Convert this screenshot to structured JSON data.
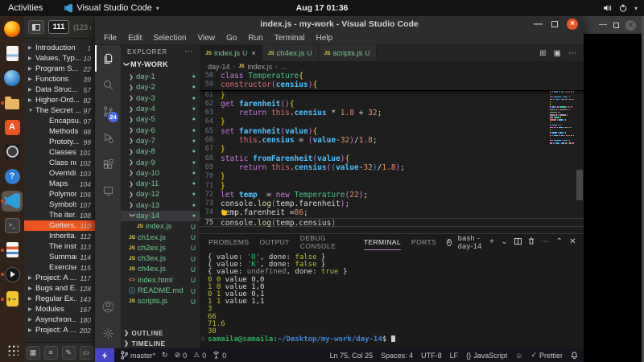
{
  "gnome": {
    "activities": "Activities",
    "app_menu": "Visual Studio Code",
    "clock": "Aug 17 01:36"
  },
  "dock": {
    "items": [
      {
        "id": "firefox",
        "running": false,
        "focused": false
      },
      {
        "id": "writer",
        "running": false,
        "focused": false
      },
      {
        "id": "tbird",
        "running": false,
        "focused": false
      },
      {
        "id": "files",
        "running": true,
        "focused": false
      },
      {
        "id": "software",
        "running": false,
        "focused": false
      },
      {
        "id": "rhythm",
        "running": false,
        "focused": false
      },
      {
        "id": "help",
        "running": false,
        "focused": false
      },
      {
        "id": "vscode",
        "running": true,
        "focused": true
      },
      {
        "id": "terminal",
        "running": false,
        "focused": false
      },
      {
        "id": "impress",
        "running": true,
        "focused": false
      },
      {
        "id": "player",
        "running": true,
        "focused": false
      },
      {
        "id": "calc",
        "running": true,
        "focused": false
      }
    ],
    "show_apps": {
      "id": "apps"
    }
  },
  "pdf_viewer": {
    "page_input": "111",
    "page_total": "(123 o",
    "toc": [
      {
        "label": "Introduction",
        "page": "1",
        "level": 0,
        "state": "c"
      },
      {
        "label": "Values, Typ...",
        "page": "10",
        "level": 0,
        "state": "c"
      },
      {
        "label": "Program S...",
        "page": "22",
        "level": 0,
        "state": "c"
      },
      {
        "label": "Functions",
        "page": "39",
        "level": 0,
        "state": "c"
      },
      {
        "label": "Data Struc...",
        "page": "57",
        "level": 0,
        "state": "c"
      },
      {
        "label": "Higher-Ord...",
        "page": "82",
        "level": 0,
        "state": "c"
      },
      {
        "label": "The Secret ...",
        "page": "97",
        "level": 0,
        "state": "e"
      },
      {
        "label": "Encapsu...",
        "page": "97",
        "level": 1,
        "state": ""
      },
      {
        "label": "Methods",
        "page": "98",
        "level": 1,
        "state": ""
      },
      {
        "label": "Prototy...",
        "page": "99",
        "level": 1,
        "state": ""
      },
      {
        "label": "Classes",
        "page": "101",
        "level": 1,
        "state": ""
      },
      {
        "label": "Class no...",
        "page": "102",
        "level": 1,
        "state": ""
      },
      {
        "label": "Overridi...",
        "page": "103",
        "level": 1,
        "state": ""
      },
      {
        "label": "Maps",
        "page": "104",
        "level": 1,
        "state": ""
      },
      {
        "label": "Polymor...",
        "page": "106",
        "level": 1,
        "state": ""
      },
      {
        "label": "Symbols",
        "page": "107",
        "level": 1,
        "state": ""
      },
      {
        "label": "The iter...",
        "page": "108",
        "level": 1,
        "state": ""
      },
      {
        "label": "Getters,...",
        "page": "110",
        "level": 1,
        "state": "",
        "selected": true
      },
      {
        "label": "Inherita...",
        "page": "112",
        "level": 1,
        "state": ""
      },
      {
        "label": "The inst...",
        "page": "113",
        "level": 1,
        "state": ""
      },
      {
        "label": "Summary",
        "page": "114",
        "level": 1,
        "state": ""
      },
      {
        "label": "Exercises",
        "page": "115",
        "level": 1,
        "state": ""
      },
      {
        "label": "Project: A ...",
        "page": "117",
        "level": 0,
        "state": "c"
      },
      {
        "label": "Bugs and E...",
        "page": "128",
        "level": 0,
        "state": "c"
      },
      {
        "label": "Regular Ex...",
        "page": "143",
        "level": 0,
        "state": "c"
      },
      {
        "label": "Modules",
        "page": "167",
        "level": 0,
        "state": "c"
      },
      {
        "label": "Asynchron...",
        "page": "180",
        "level": 0,
        "state": "c"
      },
      {
        "label": "Project: A ...",
        "page": "202",
        "level": 0,
        "state": "c"
      }
    ]
  },
  "vscode": {
    "title": "index.js - my-work - Visual Studio Code",
    "menus": [
      "File",
      "Edit",
      "Selection",
      "View",
      "Go",
      "Run",
      "Terminal",
      "Help"
    ],
    "activity": {
      "scm_badge": "24"
    },
    "explorer": {
      "header": "EXPLORER",
      "root": "MY-WORK",
      "outline": "OUTLINE",
      "timeline": "TIMELINE",
      "items": [
        {
          "label": "day-1",
          "kind": "folder",
          "badge": "dot"
        },
        {
          "label": "day-2",
          "kind": "folder",
          "badge": "dot"
        },
        {
          "label": "day-3",
          "kind": "folder",
          "badge": "dot"
        },
        {
          "label": "day-4",
          "kind": "folder",
          "badge": "dot"
        },
        {
          "label": "day-5",
          "kind": "folder",
          "badge": "dot"
        },
        {
          "label": "day-6",
          "kind": "folder",
          "badge": "dot"
        },
        {
          "label": "day-7",
          "kind": "folder",
          "badge": "dot"
        },
        {
          "label": "day-8",
          "kind": "folder",
          "badge": "dot"
        },
        {
          "label": "day-9",
          "kind": "folder",
          "badge": "dot"
        },
        {
          "label": "day-10",
          "kind": "folder",
          "badge": "dot"
        },
        {
          "label": "day-11",
          "kind": "folder",
          "badge": "dot"
        },
        {
          "label": "day-12",
          "kind": "folder",
          "badge": "dot"
        },
        {
          "label": "day-13",
          "kind": "folder",
          "badge": "dot"
        },
        {
          "label": "day-14",
          "kind": "folder",
          "open": true,
          "selected": true,
          "badge": "dot"
        },
        {
          "label": "index.js",
          "kind": "js",
          "badge": "U",
          "child": true
        },
        {
          "label": "ch1ex.js",
          "kind": "js",
          "badge": "U"
        },
        {
          "label": "ch2ex.js",
          "kind": "js",
          "badge": "U"
        },
        {
          "label": "ch3ex.js",
          "kind": "js",
          "badge": "U"
        },
        {
          "label": "ch4ex.js",
          "kind": "js",
          "badge": "U"
        },
        {
          "label": "index.html",
          "kind": "html",
          "badge": "U"
        },
        {
          "label": "README.md",
          "kind": "md",
          "badge": "U"
        },
        {
          "label": "scripts.js",
          "kind": "js",
          "badge": "U"
        }
      ]
    },
    "tabs": [
      {
        "label": "index.js",
        "badge": "U",
        "active": true,
        "closable": true
      },
      {
        "label": "ch4ex.js",
        "badge": "U"
      },
      {
        "label": "scripts.js",
        "badge": "U"
      }
    ],
    "breadcrumb": [
      {
        "label": "day-14"
      },
      {
        "label": "index.js",
        "icon": "js"
      },
      {
        "label": "..."
      }
    ],
    "code": {
      "sticky": [
        {
          "n": "58",
          "seg": [
            [
              "kw",
              "class "
            ],
            [
              "cls",
              "Temperature"
            ],
            [
              "g",
              "{"
            ]
          ]
        },
        {
          "n": "59",
          "seg": [
            [
              "rd",
              "constructor"
            ],
            [
              "m",
              "("
            ],
            [
              "vr",
              "censius"
            ],
            [
              "m",
              ")"
            ],
            [
              "g",
              "{"
            ]
          ]
        }
      ],
      "lines": [
        {
          "n": "61",
          "seg": [
            [
              "g",
              "}"
            ]
          ]
        },
        {
          "n": "62",
          "seg": [
            [
              "kw",
              "get "
            ],
            [
              "vr",
              "farenheit"
            ],
            [
              "m",
              "()"
            ],
            [
              "g",
              "{"
            ]
          ]
        },
        {
          "n": "63",
          "seg": [
            [
              "pw",
              "    "
            ],
            [
              "kw",
              "return "
            ],
            [
              "th",
              "this"
            ],
            [
              "pw",
              "."
            ],
            [
              "vr",
              "censius"
            ],
            [
              "pw",
              " * "
            ],
            [
              "nm",
              "1.8"
            ],
            [
              "pw",
              " + "
            ],
            [
              "nm",
              "32"
            ],
            [
              "pw",
              ";"
            ]
          ]
        },
        {
          "n": "64",
          "seg": [
            [
              "g",
              "}"
            ]
          ]
        },
        {
          "n": "65",
          "seg": [
            [
              "kw",
              "set "
            ],
            [
              "vr",
              "farenheit"
            ],
            [
              "m",
              "("
            ],
            [
              "vr",
              "value"
            ],
            [
              "m",
              ")"
            ],
            [
              "g",
              "{"
            ]
          ]
        },
        {
          "n": "66",
          "seg": [
            [
              "pw",
              "    "
            ],
            [
              "th",
              "this"
            ],
            [
              "pw",
              "."
            ],
            [
              "vr",
              "censius"
            ],
            [
              "pw",
              " = "
            ],
            [
              "m",
              "("
            ],
            [
              "vr",
              "value"
            ],
            [
              "pw",
              "-"
            ],
            [
              "nm",
              "32"
            ],
            [
              "m",
              ")"
            ],
            [
              "pw",
              "/"
            ],
            [
              "nm",
              "1.8"
            ],
            [
              "pw",
              ";"
            ]
          ]
        },
        {
          "n": "67",
          "seg": [
            [
              "g",
              "}"
            ]
          ]
        },
        {
          "n": "68",
          "seg": [
            [
              "kw",
              "static "
            ],
            [
              "vr",
              "fromFarenheit"
            ],
            [
              "m",
              "("
            ],
            [
              "vr",
              "value"
            ],
            [
              "m",
              ")"
            ],
            [
              "g",
              "{"
            ]
          ]
        },
        {
          "n": "69",
          "seg": [
            [
              "pw",
              "    "
            ],
            [
              "kw",
              "return "
            ],
            [
              "th",
              "this"
            ],
            [
              "pw",
              "."
            ],
            [
              "vr",
              "censius"
            ],
            [
              "m",
              "("
            ],
            [
              "b",
              "("
            ],
            [
              "vr",
              "value"
            ],
            [
              "pw",
              "-"
            ],
            [
              "nm",
              "32"
            ],
            [
              "b",
              ")"
            ],
            [
              "pw",
              "/"
            ],
            [
              "nm",
              "1.8"
            ],
            [
              "m",
              ")"
            ],
            [
              "pw",
              ";"
            ]
          ]
        },
        {
          "n": "70",
          "seg": [
            [
              "g",
              "}"
            ]
          ]
        },
        {
          "n": "71",
          "seg": [
            [
              "g",
              "}"
            ]
          ]
        },
        {
          "n": "72",
          "seg": [
            [
              "kw",
              "let "
            ],
            [
              "vr",
              "temp"
            ],
            [
              "pw",
              "  = "
            ],
            [
              "kw",
              "new "
            ],
            [
              "cls",
              "Temperature"
            ],
            [
              "m",
              "("
            ],
            [
              "nm",
              "22"
            ],
            [
              "m",
              ")"
            ],
            [
              "pw",
              ";"
            ]
          ]
        },
        {
          "n": "73",
          "seg": [
            [
              "pw",
              "console."
            ],
            [
              "fy",
              "log"
            ],
            [
              "m",
              "("
            ],
            [
              "pw",
              "temp.farenheit"
            ],
            [
              "m",
              ")"
            ],
            [
              "pw",
              ";"
            ]
          ]
        },
        {
          "n": "74",
          "bulb": true,
          "seg": [
            [
              "pw",
              "temp.farenheit ="
            ],
            [
              "nm",
              "86"
            ],
            [
              "pw",
              ";"
            ]
          ]
        },
        {
          "n": "75",
          "cur": true,
          "seg": [
            [
              "pw",
              "console."
            ],
            [
              "fy",
              "log"
            ],
            [
              "m",
              "("
            ],
            [
              "pw",
              "temp.censius"
            ],
            [
              "m",
              ")"
            ]
          ]
        }
      ]
    },
    "panel": {
      "tabs": [
        {
          "label": "PROBLEMS"
        },
        {
          "label": "OUTPUT"
        },
        {
          "label": "DEBUG CONSOLE"
        },
        {
          "label": "TERMINAL",
          "active": true
        },
        {
          "label": "PORTS"
        }
      ],
      "shell_label": "bash - day-14",
      "terminal": [
        {
          "seg": [
            [
              "w",
              "{ value: "
            ],
            [
              "gq",
              "'O'"
            ],
            [
              "w",
              ", done: "
            ],
            [
              "yl",
              "false"
            ],
            [
              "w",
              " }"
            ]
          ]
        },
        {
          "seg": [
            [
              "w",
              "{ value: "
            ],
            [
              "gq",
              "'K'"
            ],
            [
              "w",
              ", done: "
            ],
            [
              "yl",
              "false"
            ],
            [
              "w",
              " }"
            ]
          ]
        },
        {
          "seg": [
            [
              "w",
              "{ value: "
            ],
            [
              "gr",
              "undefined"
            ],
            [
              "w",
              ", done: "
            ],
            [
              "yl",
              "true"
            ],
            [
              "w",
              " }"
            ]
          ]
        },
        {
          "seg": [
            [
              "yl",
              "0 0"
            ],
            [
              "w",
              " value 0,0"
            ]
          ]
        },
        {
          "seg": [
            [
              "yl",
              "1 0"
            ],
            [
              "w",
              " value 1,0"
            ]
          ]
        },
        {
          "seg": [
            [
              "yl",
              "0 1"
            ],
            [
              "w",
              " value 0,1"
            ]
          ]
        },
        {
          "seg": [
            [
              "yl",
              "1 1"
            ],
            [
              "w",
              " value 1,1"
            ]
          ]
        },
        {
          "seg": [
            [
              "yl",
              "3"
            ]
          ]
        },
        {
          "seg": [
            [
              "yl",
              "66"
            ]
          ]
        },
        {
          "seg": [
            [
              "yl",
              "71.6"
            ]
          ]
        },
        {
          "seg": [
            [
              "yl",
              "30"
            ]
          ]
        },
        {
          "prompt": true,
          "cursor": true,
          "seg": [
            [
              "pg",
              "samaila@samaila"
            ],
            [
              "w",
              ":"
            ],
            [
              "pb",
              "~/Desktop/my-work/day-14"
            ],
            [
              "w",
              "$ "
            ]
          ]
        }
      ]
    },
    "status": {
      "left": [
        {
          "icon": "branch",
          "label": "master*"
        },
        {
          "icon": "sync",
          "label": ""
        },
        {
          "icon": "error",
          "label": "0"
        },
        {
          "icon": "warn",
          "label": "0"
        },
        {
          "icon": "tower",
          "label": "0"
        }
      ],
      "right": [
        {
          "label": "Ln 75, Col 25"
        },
        {
          "label": "Spaces: 4"
        },
        {
          "label": "UTF-8"
        },
        {
          "label": "LF"
        },
        {
          "icon": "braces",
          "label": "JavaScript"
        },
        {
          "icon": "smiley",
          "label": ""
        },
        {
          "icon": "check",
          "label": "Prettier"
        },
        {
          "icon": "bell",
          "label": ""
        }
      ]
    }
  }
}
